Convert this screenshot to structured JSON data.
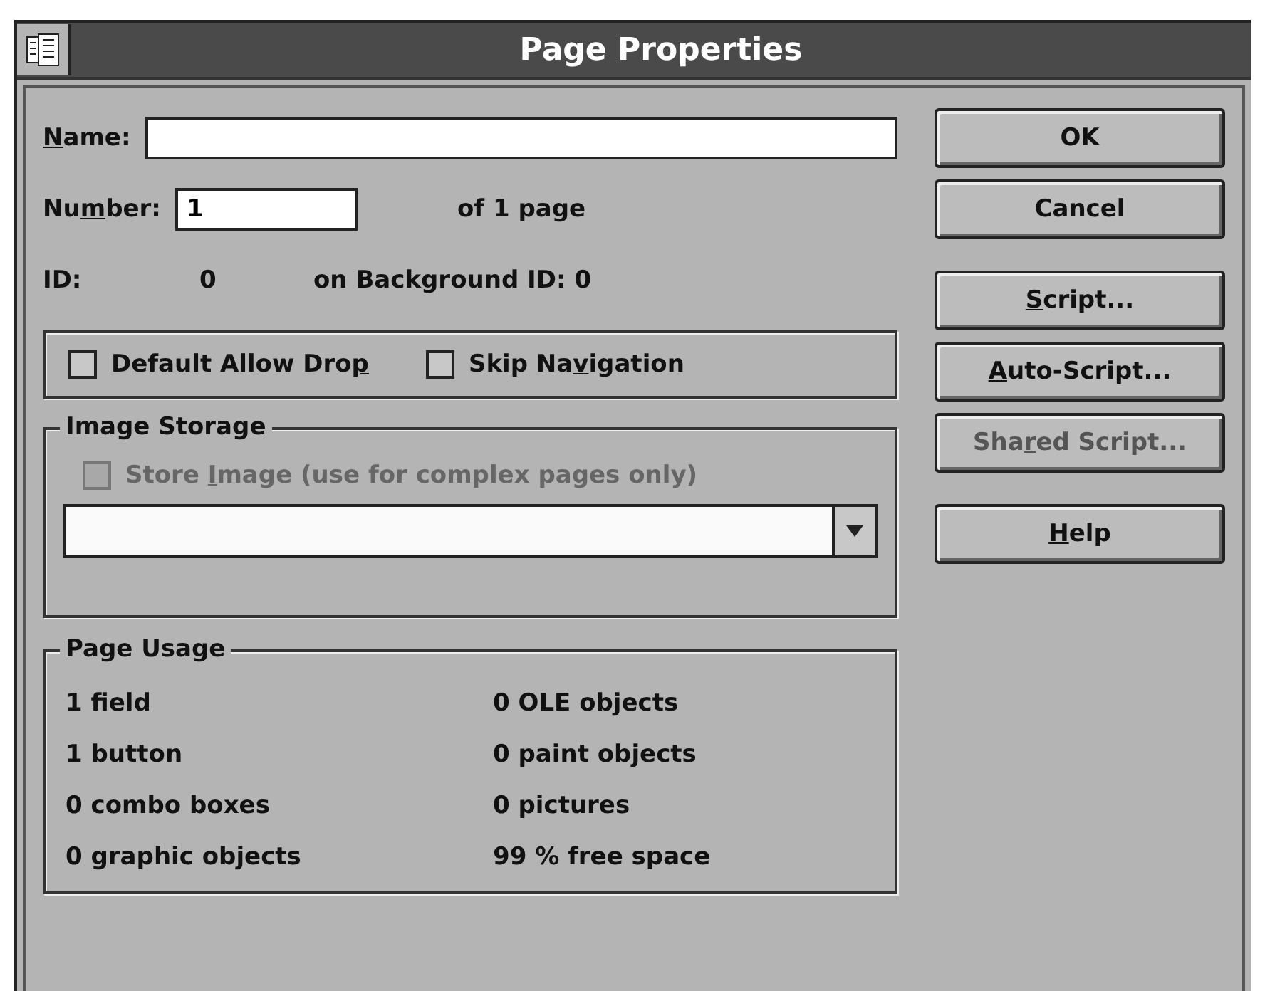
{
  "window": {
    "title": "Page Properties"
  },
  "name_field": {
    "label": {
      "key": "N",
      "post": "ame:"
    }
  },
  "number_field": {
    "label": {
      "pre": "Nu",
      "key": "m",
      "post": "ber:"
    },
    "value": "1",
    "suffix": "of  1 page"
  },
  "id_row": {
    "label": "ID:",
    "value": "0",
    "background": "on Background ID: 0"
  },
  "options": [
    {
      "label": {
        "pre": "Default Allow Dro",
        "key": "p"
      },
      "checked": false,
      "disabled": false
    },
    {
      "label": {
        "pre": "Skip Na",
        "key": "v",
        "post": "igation"
      },
      "checked": false,
      "disabled": false
    }
  ],
  "image_storage": {
    "title": "Image Storage",
    "checkbox": {
      "label": {
        "pre": "Store ",
        "key": "I",
        "post": "mage (use for complex pages only)"
      },
      "checked": false,
      "disabled": true
    }
  },
  "page_usage": {
    "title": "Page Usage",
    "left": [
      "1 field",
      "1 button",
      "0 combo boxes",
      "0 graphic objects"
    ],
    "right": [
      "0 OLE objects",
      "0 paint objects",
      "0 pictures",
      "99 % free space"
    ]
  },
  "button_groups": [
    [
      {
        "label": {
          "post": "OK"
        },
        "disabled": false
      },
      {
        "label": {
          "post": "Cancel"
        },
        "disabled": false
      }
    ],
    [
      {
        "label": {
          "key": "S",
          "post": "cript..."
        },
        "disabled": false
      },
      {
        "label": {
          "key": "A",
          "post": "uto-Script..."
        },
        "disabled": false
      },
      {
        "label": {
          "pre": "Sha",
          "key": "r",
          "post": "ed Script..."
        },
        "disabled": true
      }
    ],
    [
      {
        "label": {
          "key": "H",
          "post": "elp"
        },
        "disabled": false
      }
    ]
  ]
}
